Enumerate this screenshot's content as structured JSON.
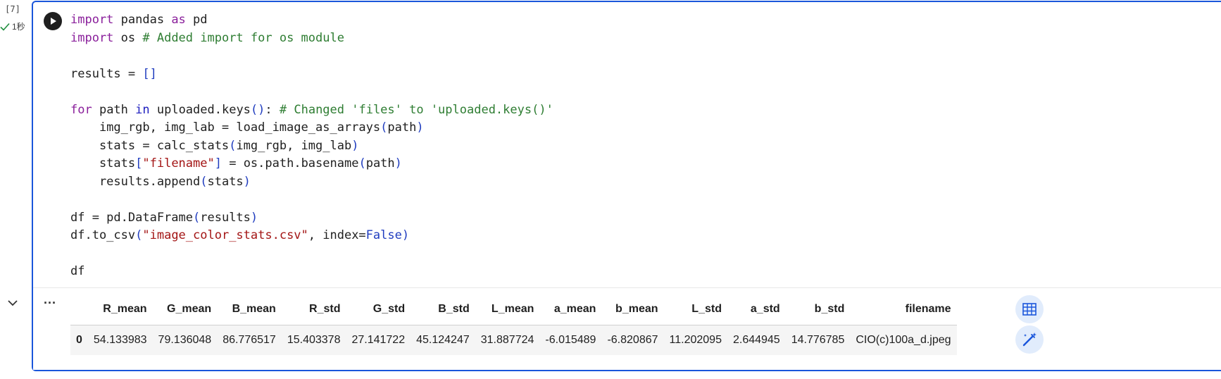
{
  "gutter": {
    "exec_count": "[7]",
    "exec_time": "1秒",
    "status_color": "#1e8e3e"
  },
  "code": {
    "lines": [
      [
        {
          "t": "import",
          "c": "kw"
        },
        {
          "t": " pandas "
        },
        {
          "t": "as",
          "c": "kw"
        },
        {
          "t": " pd"
        }
      ],
      [
        {
          "t": "import",
          "c": "kw"
        },
        {
          "t": " os "
        },
        {
          "t": "# Added import for os module",
          "c": "cm"
        }
      ],
      [],
      [
        {
          "t": "results = "
        },
        {
          "t": "[]",
          "c": "br"
        }
      ],
      [],
      [
        {
          "t": "for",
          "c": "kw"
        },
        {
          "t": " path "
        },
        {
          "t": "in",
          "c": "kw2"
        },
        {
          "t": " uploaded.keys"
        },
        {
          "t": "()",
          "c": "br"
        },
        {
          "t": ": "
        },
        {
          "t": "# Changed 'files' to 'uploaded.keys()'",
          "c": "cm"
        }
      ],
      [
        {
          "t": "    img_rgb, img_lab = load_image_as_arrays"
        },
        {
          "t": "(",
          "c": "br"
        },
        {
          "t": "path"
        },
        {
          "t": ")",
          "c": "br"
        }
      ],
      [
        {
          "t": "    stats = calc_stats"
        },
        {
          "t": "(",
          "c": "br"
        },
        {
          "t": "img_rgb, img_lab"
        },
        {
          "t": ")",
          "c": "br"
        }
      ],
      [
        {
          "t": "    stats"
        },
        {
          "t": "[",
          "c": "br"
        },
        {
          "t": "\"filename\"",
          "c": "st"
        },
        {
          "t": "]",
          "c": "br"
        },
        {
          "t": " = os.path.basename"
        },
        {
          "t": "(",
          "c": "br"
        },
        {
          "t": "path"
        },
        {
          "t": ")",
          "c": "br"
        }
      ],
      [
        {
          "t": "    results.append"
        },
        {
          "t": "(",
          "c": "br"
        },
        {
          "t": "stats"
        },
        {
          "t": ")",
          "c": "br"
        }
      ],
      [],
      [
        {
          "t": "df = pd.DataFrame"
        },
        {
          "t": "(",
          "c": "br"
        },
        {
          "t": "results"
        },
        {
          "t": ")",
          "c": "br"
        }
      ],
      [
        {
          "t": "df.to_csv"
        },
        {
          "t": "(",
          "c": "br"
        },
        {
          "t": "\"image_color_stats.csv\"",
          "c": "st"
        },
        {
          "t": ", index="
        },
        {
          "t": "False",
          "c": "bool"
        },
        {
          "t": ")",
          "c": "br"
        }
      ],
      [],
      [
        {
          "t": "df"
        }
      ]
    ]
  },
  "output": {
    "menu_label": "...",
    "columns": [
      "",
      "R_mean",
      "G_mean",
      "B_mean",
      "R_std",
      "G_std",
      "B_std",
      "L_mean",
      "a_mean",
      "b_mean",
      "L_std",
      "a_std",
      "b_std",
      "filename"
    ],
    "rows": [
      [
        "0",
        "54.133983",
        "79.136048",
        "86.776517",
        "15.403378",
        "27.141722",
        "45.124247",
        "31.887724",
        "-6.015489",
        "-6.820867",
        "11.202095",
        "2.644945",
        "14.776785",
        "CIO(c)100a_d.jpeg"
      ]
    ]
  },
  "colors": {
    "accent": "#2b5ed0",
    "side_button_bg": "#e1ecfc",
    "side_button_icon": "#1a56db"
  },
  "icons": {
    "run": "play-icon",
    "collapse": "chevron-down-icon",
    "table_view": "table-icon",
    "magic_edit": "magic-wand-icon"
  }
}
